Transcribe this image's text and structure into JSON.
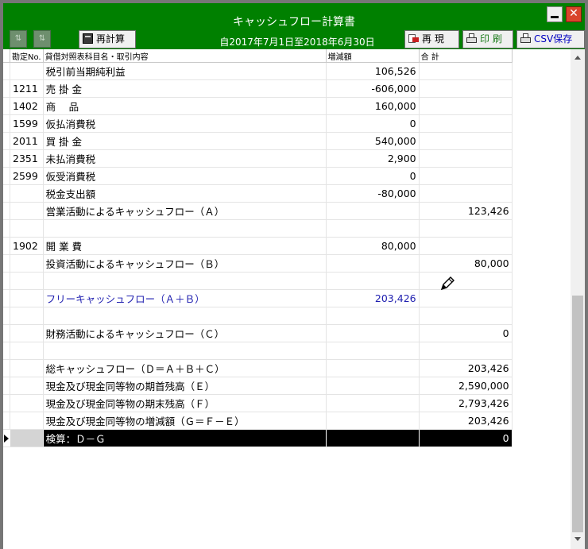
{
  "window": {
    "title": "キャッシュフロー計算書",
    "minimize_icon": "minimize-icon",
    "close_icon": "close-icon",
    "close_glyph": "✕"
  },
  "toolbar": {
    "recalc_label": "再計算",
    "period_label": "自2017年7月1日至2018年6月30日",
    "restore_label": "再 現",
    "print_label": "印 刷",
    "csv_label": "CSV保存",
    "left_icon_1": "sort-asc-icon",
    "left_icon_2": "sort-desc-icon"
  },
  "table": {
    "headers": {
      "code": "勘定No.",
      "name": "貸借対照表科目名・取引内容",
      "amount": "増減額",
      "total": "合 計"
    },
    "rows": [
      {
        "code": "",
        "name": "税引前当期純利益",
        "amount": "106,526",
        "total": ""
      },
      {
        "code": "1211",
        "name": "売 掛 金",
        "amount": "-606,000",
        "total": ""
      },
      {
        "code": "1402",
        "name": "商　 品",
        "amount": "160,000",
        "total": ""
      },
      {
        "code": "1599",
        "name": "仮払消費税",
        "amount": "0",
        "total": ""
      },
      {
        "code": "2011",
        "name": "買 掛 金",
        "amount": "540,000",
        "total": ""
      },
      {
        "code": "2351",
        "name": "未払消費税",
        "amount": "2,900",
        "total": ""
      },
      {
        "code": "2599",
        "name": "仮受消費税",
        "amount": "0",
        "total": ""
      },
      {
        "code": "",
        "name": "税金支出額",
        "amount": "-80,000",
        "total": ""
      },
      {
        "code": "",
        "name": "営業活動によるキャッシュフロー（Ａ）",
        "amount": "",
        "total": "123,426"
      },
      {
        "code": "",
        "name": "",
        "amount": "",
        "total": ""
      },
      {
        "code": "1902",
        "name": "開 業 費",
        "amount": "80,000",
        "total": ""
      },
      {
        "code": "",
        "name": "投資活動によるキャッシュフロー（Ｂ）",
        "amount": "",
        "total": "80,000"
      },
      {
        "code": "",
        "name": "",
        "amount": "",
        "total": ""
      },
      {
        "code": "",
        "name": "フリーキャッシュフロー（Ａ＋Ｂ）",
        "amount": "203,426",
        "total": "",
        "style": "blue"
      },
      {
        "code": "",
        "name": "",
        "amount": "",
        "total": ""
      },
      {
        "code": "",
        "name": "財務活動によるキャッシュフロー（Ｃ）",
        "amount": "",
        "total": "0"
      },
      {
        "code": "",
        "name": "",
        "amount": "",
        "total": ""
      },
      {
        "code": "",
        "name": "総キャッシュフロー（Ｄ＝Ａ＋Ｂ＋Ｃ）",
        "amount": "",
        "total": "203,426"
      },
      {
        "code": "",
        "name": "現金及び現金同等物の期首残高（Ｅ）",
        "amount": "",
        "total": "2,590,000"
      },
      {
        "code": "",
        "name": "現金及び現金同等物の期末残高（Ｆ）",
        "amount": "",
        "total": "2,793,426"
      },
      {
        "code": "",
        "name": "現金及び現金同等物の増減額（Ｇ＝Ｆ－Ｅ）",
        "amount": "",
        "total": "203,426"
      },
      {
        "code": "",
        "name": "検算：Ｄ－Ｇ",
        "amount": "",
        "total": "0",
        "style": "black"
      }
    ]
  },
  "cursor": {
    "icon": "pencil-icon"
  }
}
